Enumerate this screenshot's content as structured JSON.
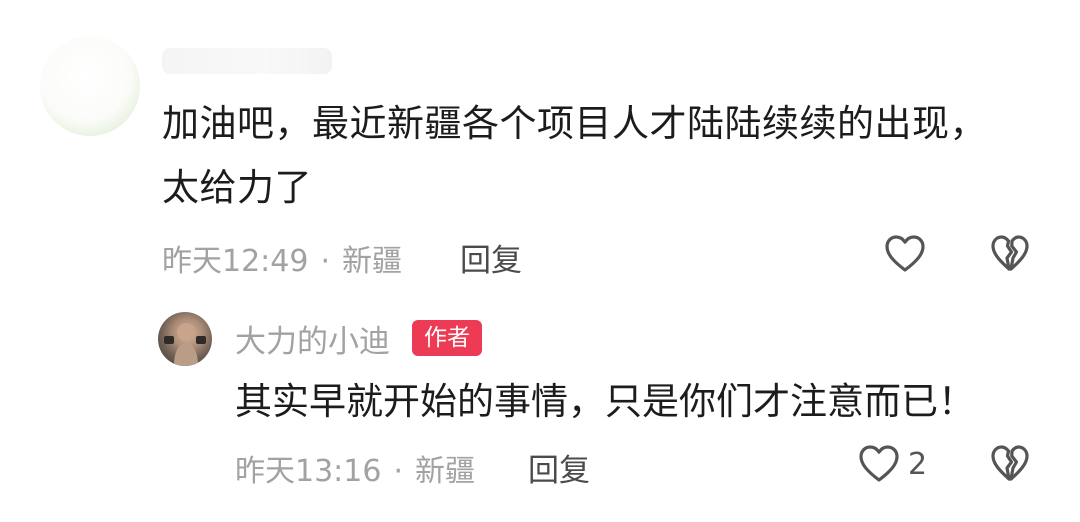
{
  "top_comment": {
    "username": "",
    "text_line1": "加油吧，最近新疆各个项目人才陆陆续续的出现，",
    "text_line2": "太给力了",
    "time": "昨天12:49",
    "separator": "·",
    "location": "新疆",
    "reply_label": "回复",
    "like_count": ""
  },
  "reply_comment": {
    "username": "大力的小迪",
    "badge": "作者",
    "text": "其实早就开始的事情，只是你们才注意而已！",
    "time": "昨天13:16",
    "separator": "·",
    "location": "新疆",
    "reply_label": "回复",
    "like_count": "2"
  },
  "icons": {
    "like": "heart-outline-icon",
    "dislike": "broken-heart-icon"
  },
  "colors": {
    "badge_bg": "#ee3b55",
    "meta_text": "#a2a2a2",
    "body_text": "#1c1c1c",
    "icon_stroke": "#555555"
  }
}
